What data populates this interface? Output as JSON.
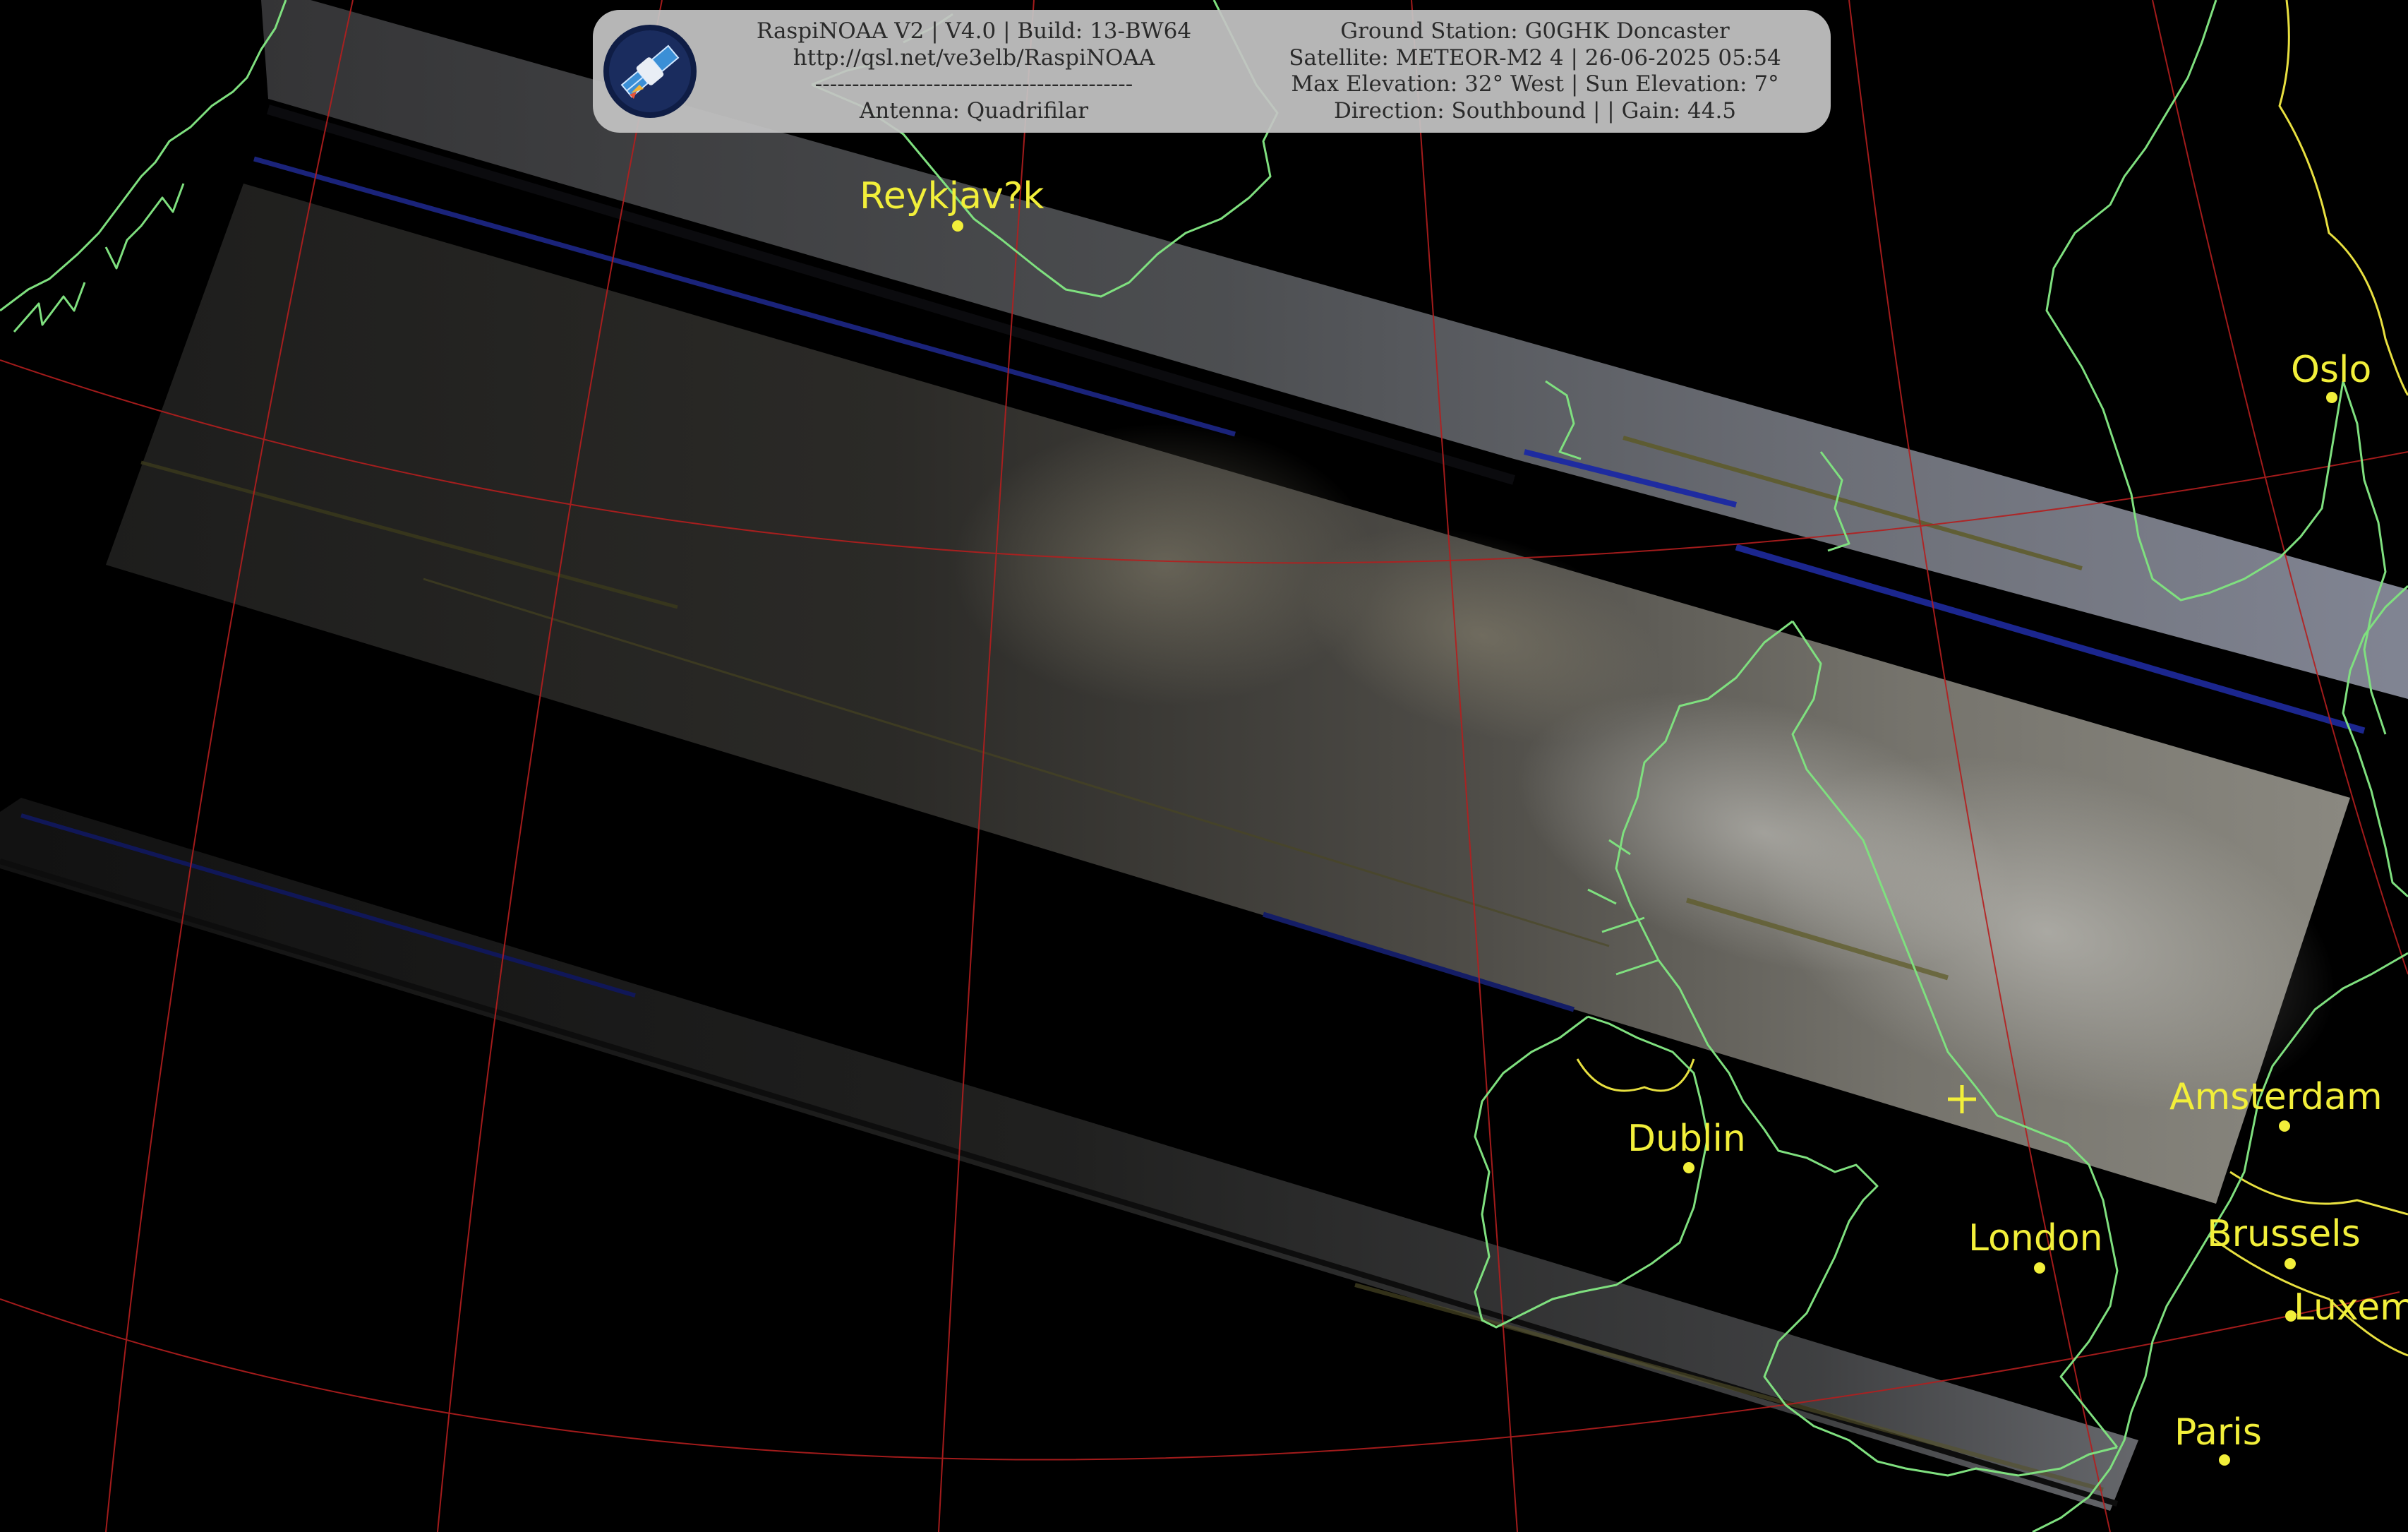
{
  "info": {
    "app_line": "RaspiNOAA V2 | V4.0 | Build: 13-BW64",
    "url_line": "http://qsl.net/ve3elb/RaspiNOAA",
    "separator_line": "-------------------------------------------",
    "antenna_line": "Antenna: Quadrifilar",
    "station_line": "Ground Station: G0GHK Doncaster",
    "satellite_line": "Satellite: METEOR-M2 4 | 26-06-2025 05:54",
    "elevation_line": "Max Elevation: 32° West | Sun Elevation: 7°",
    "direction_line": "Direction: Southbound | | Gain: 44.5"
  },
  "cities": {
    "reykjavik": "Reykjav?k",
    "oslo": "Oslo",
    "dublin": "Dublin",
    "amsterdam": "Amsterdam",
    "london": "London",
    "brussels": "Brussels",
    "luxembourg": "Luxem",
    "paris": "Paris"
  },
  "colors": {
    "coastline": "#7fe07f",
    "border": "#e8e040",
    "graticule": "#b41e1e",
    "city_label": "#f2ef3a",
    "background": "#000000"
  },
  "icons": {
    "logo": "satellite-icon",
    "ground_station": "crosshair-icon"
  }
}
